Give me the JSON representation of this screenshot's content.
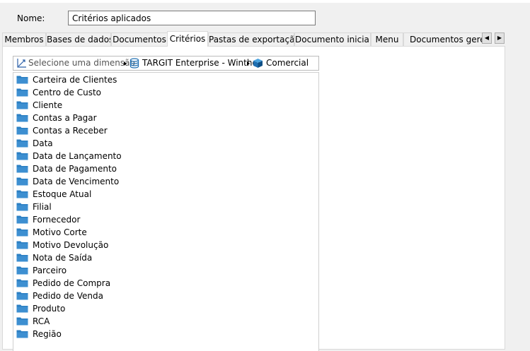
{
  "form": {
    "name_label": "Nome:",
    "name_value": "Critérios aplicados"
  },
  "tabs": [
    {
      "label": "Membros",
      "active": false
    },
    {
      "label": "Bases de dados",
      "active": false
    },
    {
      "label": "Documentos",
      "active": false
    },
    {
      "label": "Critérios",
      "active": true
    },
    {
      "label": "Pastas de exportação",
      "active": false
    },
    {
      "label": "Documento inicial",
      "active": false
    },
    {
      "label": "Menu",
      "active": false
    },
    {
      "label": "Documentos gerenciados",
      "active": false
    }
  ],
  "breadcrumb": {
    "dimension_prompt": "Selecione uma dimensão",
    "database": "TARGIT Enterprise - Winthor",
    "cube": "Comercial"
  },
  "tree_items": [
    "Carteira de Clientes",
    "Centro de Custo",
    "Cliente",
    "Contas a Pagar",
    "Contas a Receber",
    "Data",
    "Data de Lançamento",
    "Data de Pagamento",
    "Data de Vencimento",
    "Estoque Atual",
    "Filial",
    "Fornecedor",
    "Motivo Corte",
    "Motivo Devolução",
    "Nota de Saída",
    "Parceiro",
    "Pedido de Compra",
    "Pedido de Venda",
    "Produto",
    "RCA",
    "Região"
  ],
  "icons": {
    "tree_item": "folder-icon",
    "dimension": "axis-icon",
    "database": "database-icon",
    "cube": "cube-icon"
  },
  "colors": {
    "folder": "#2b7fc3",
    "active_tab_bg": "#ffffff"
  }
}
